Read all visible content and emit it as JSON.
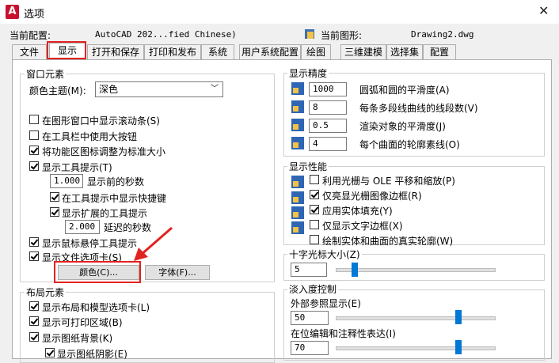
{
  "window": {
    "title": "选项",
    "app_icon": "A"
  },
  "header": {
    "current_profile_label": "当前配置:",
    "current_profile_value": "AutoCAD 202...fied Chinese)",
    "current_drawing_label": "当前图形:",
    "current_drawing_value": "Drawing2.dwg"
  },
  "tabs": [
    "文件",
    "显示",
    "打开和保存",
    "打印和发布",
    "系统",
    "用户系统配置",
    "绘图",
    "三维建模",
    "选择集",
    "配置"
  ],
  "window_elements": {
    "title": "窗口元素",
    "color_theme_label": "颜色主题(M):",
    "color_theme_value": "深色",
    "checks": [
      {
        "label": "在图形窗口中显示滚动条(S)",
        "checked": false
      },
      {
        "label": "在工具栏中使用大按钮",
        "checked": false
      },
      {
        "label": "将功能区图标调整为标准大小",
        "checked": true
      },
      {
        "label": "显示工具提示(T)",
        "checked": true
      }
    ],
    "delay_value": "1.000",
    "delay_label": "显示前的秒数",
    "show_shortcut_label": "在工具提示中显示快捷键",
    "show_extended_label": "显示扩展的工具提示",
    "ext_delay_value": "2.000",
    "ext_delay_label": "延迟的秒数",
    "rollover_label": "显示鼠标悬停工具提示",
    "file_tabs_label": "显示文件选项卡(S)",
    "colors_button": "颜色(C)...",
    "fonts_button": "字体(F)..."
  },
  "layout_elements": {
    "title": "布局元素",
    "checks": [
      {
        "label": "显示布局和模型选项卡(L)",
        "checked": true
      },
      {
        "label": "显示可打印区域(B)",
        "checked": true
      },
      {
        "label": "显示图纸背景(K)",
        "checked": true
      }
    ],
    "paper_shadow_label": "显示图纸阴影(E)"
  },
  "display_resolution": {
    "title": "显示精度",
    "rows": [
      {
        "value": "1000",
        "label": "圆弧和圆的平滑度(A)"
      },
      {
        "value": "8",
        "label": "每条多段线曲线的线段数(V)"
      },
      {
        "value": "0.5",
        "label": "渲染对象的平滑度(J)"
      },
      {
        "value": "4",
        "label": "每个曲面的轮廓素线(O)"
      }
    ]
  },
  "display_performance": {
    "title": "显示性能",
    "checks": [
      {
        "label": "利用光栅与 OLE 平移和缩放(P)",
        "checked": false
      },
      {
        "label": "仅亮显光栅图像边框(R)",
        "checked": true
      },
      {
        "label": "应用实体填充(Y)",
        "checked": true
      },
      {
        "label": "仅显示文字边框(X)",
        "checked": false
      },
      {
        "label": "绘制实体和曲面的真实轮廓(W)",
        "checked": false
      }
    ]
  },
  "crosshair": {
    "title": "十字光标大小(Z)",
    "value": "5",
    "level_fraction": 0.05
  },
  "fade": {
    "title": "淡入度控制",
    "xref_label": "外部参照显示(E)",
    "xref_value": "50",
    "inplace_label": "在位编辑和注释性表达(I)",
    "inplace_value": "70"
  },
  "colors": {
    "accent_red": "#e2221f",
    "slider_blue": "#0078d7"
  }
}
